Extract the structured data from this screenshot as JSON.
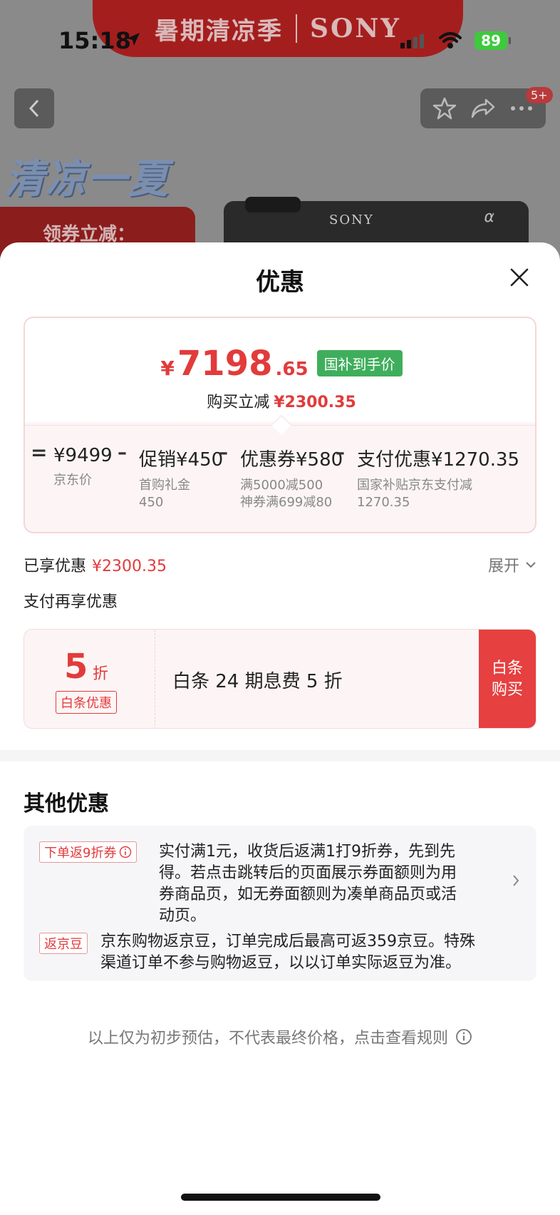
{
  "status": {
    "time": "15:18",
    "battery": "89"
  },
  "background": {
    "banner_left": "暑期清凉季",
    "banner_brand": "SONY",
    "notification_badge": "5+",
    "summer_text": "清凉一夏",
    "coupon_text": "领券立减：",
    "camera_brand": "SONY",
    "camera_alpha": "α"
  },
  "sheet": {
    "title": "优惠",
    "price": {
      "yen": "¥",
      "integer": "7198",
      "decimal": ".65",
      "tag": "国补到手价",
      "reduce_label": "购买立减",
      "reduce_value": "¥2300.35"
    },
    "breakdown": {
      "equals": "=",
      "items": [
        {
          "value": "¥9499",
          "sub1": "京东价",
          "sub2": ""
        },
        {
          "value": "促销¥450",
          "sub1": "首购礼金",
          "sub2": "450"
        },
        {
          "value": "优惠券¥580",
          "sub1": "满5000减500",
          "sub2": "神券满699减80"
        },
        {
          "value": "支付优惠¥1270.35",
          "sub1": "国家补贴京东支付减",
          "sub2": "1270.35"
        }
      ],
      "minus": "–"
    },
    "enjoyed_label": "已享优惠",
    "enjoyed_value": "¥2300.35",
    "expand_label": "展开",
    "pay_more_label": "支付再享优惠",
    "baitiao": {
      "number": "5",
      "unit": "折",
      "tag": "白条优惠",
      "text": "白条 24 期息费 5 折",
      "button": "白条购买"
    },
    "other_title": "其他优惠",
    "other_items": [
      {
        "tag": "下单返9折券",
        "text_lines": [
          "实付满1元，收货后返满1打9折券，先到先",
          "得。若点击跳转后的页面展示券面额则为用",
          "券商品页，如无券面额则为凑单商品页或活",
          "动页。"
        ]
      },
      {
        "tag": "返京豆",
        "text_lines": [
          "京东购物返京豆，订单完成后最高可返359京豆。特殊",
          "渠道订单不参与购物返豆，以以订单实际返豆为准。"
        ]
      }
    ],
    "footer_note": "以上仅为初步预估，不代表最终价格，点击查看规则"
  },
  "colors": {
    "accent_red": "#e23b3b",
    "gov_green": "#3fae5c",
    "buy_red": "#e64040"
  }
}
